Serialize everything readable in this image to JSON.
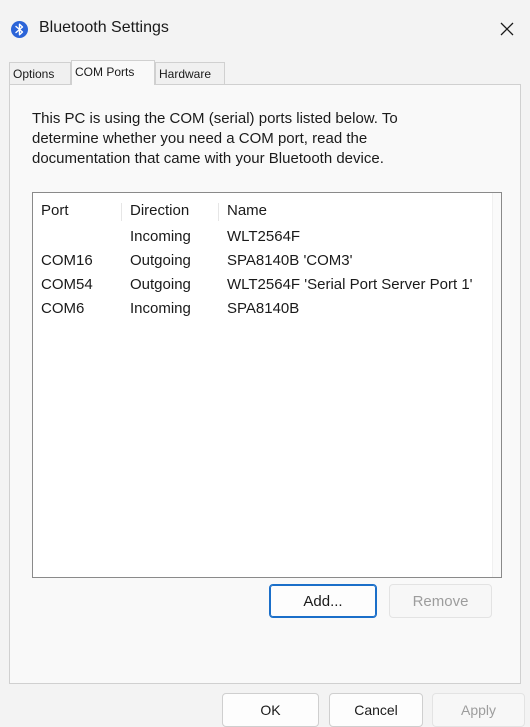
{
  "window": {
    "title": "Bluetooth Settings",
    "close_label": "✕"
  },
  "tabs": [
    {
      "label": "Options",
      "active": false
    },
    {
      "label": "COM Ports",
      "active": true
    },
    {
      "label": "Hardware",
      "active": false
    }
  ],
  "panel": {
    "description_lines": [
      "This PC is using the COM (serial) ports listed below. To",
      "determine whether you need a COM port, read the",
      "documentation that came with your Bluetooth device."
    ],
    "list": {
      "columns": [
        "Port",
        "Direction",
        "Name"
      ],
      "rows": [
        {
          "port": "",
          "direction": "Incoming",
          "name": "WLT2564F"
        },
        {
          "port": "COM16",
          "direction": "Outgoing",
          "name": "SPA8140B 'COM3'"
        },
        {
          "port": "COM54",
          "direction": "Outgoing",
          "name": "WLT2564F 'Serial Port Server Port 1'"
        },
        {
          "port": "COM6",
          "direction": "Incoming",
          "name": "SPA8140B"
        }
      ]
    },
    "add_label": "Add...",
    "remove_label": "Remove"
  },
  "footer": {
    "ok_label": "OK",
    "cancel_label": "Cancel",
    "apply_label": "Apply"
  },
  "colors": {
    "accent": "#1b6fc9",
    "bluetooth_icon": "#2b64d8",
    "disabled_text": "#9d9d9d"
  }
}
